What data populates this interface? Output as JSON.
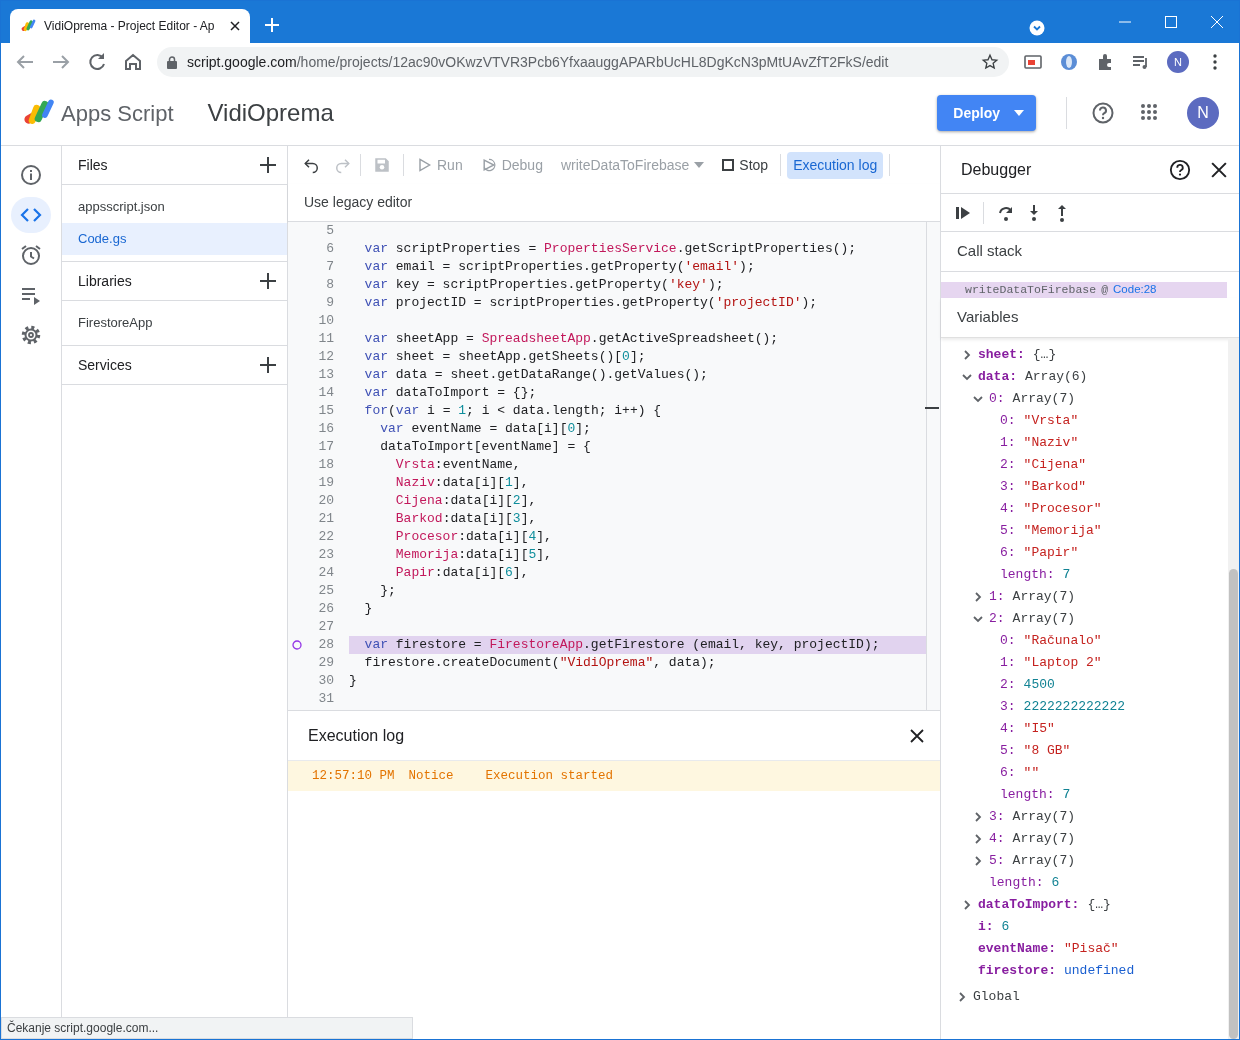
{
  "browser": {
    "tab_title": "VidiOprema - Project Editor - Ap",
    "url_host": "script.google.com",
    "url_path": "/home/projects/12ac90vOKwzVTVR3Pcb6YfxaauggAPARbUcHL8DgKcN3pMtUAvZfT2FkS/edit",
    "profile_initial": "N"
  },
  "app": {
    "product": "Apps Script",
    "project": "VidiOprema",
    "deploy_label": "Deploy",
    "account_initial": "N"
  },
  "rail": [
    {
      "selected": false
    },
    {
      "selected": true
    },
    {
      "selected": false
    },
    {
      "selected": false
    },
    {
      "selected": false
    }
  ],
  "sidebar": [
    {
      "title": "Files",
      "items": [
        {
          "label": "appsscript.json",
          "selected": false
        },
        {
          "label": "Code.gs",
          "selected": true
        }
      ]
    },
    {
      "title": "Libraries",
      "items": [
        {
          "label": "FirestoreApp",
          "selected": false
        }
      ]
    },
    {
      "title": "Services"
    }
  ],
  "toolbar": {
    "history": [
      {
        "disabled": false
      },
      {
        "disabled": true
      }
    ],
    "save": {
      "disabled": true
    },
    "actions": [
      {
        "label": "Run",
        "disabled": true
      },
      {
        "label": "Debug",
        "disabled": true
      }
    ],
    "function": {
      "label": "writeDataToFirebase",
      "disabled": true
    },
    "stop": "Stop",
    "log_button": {
      "label": "Execution log",
      "selected": true
    },
    "legacy_link": "Use legacy editor"
  },
  "code": [
    {
      "number": "5"
    },
    {
      "number": "6",
      "tokens": [
        {
          "kind": "keyword",
          "text": "  var"
        },
        {
          "kind": "plain",
          "text": " scriptProperties = "
        },
        {
          "kind": "class",
          "text": "PropertiesService"
        },
        {
          "kind": "plain",
          "text": ".getScriptProperties();"
        }
      ]
    },
    {
      "number": "7",
      "tokens": [
        {
          "kind": "keyword",
          "text": "  var"
        },
        {
          "kind": "plain",
          "text": " email = scriptProperties.getProperty("
        },
        {
          "kind": "string",
          "text": "'email'"
        },
        {
          "kind": "plain",
          "text": ");"
        }
      ]
    },
    {
      "number": "8",
      "tokens": [
        {
          "kind": "keyword",
          "text": "  var"
        },
        {
          "kind": "plain",
          "text": " key = scriptProperties.getProperty("
        },
        {
          "kind": "string",
          "text": "'key'"
        },
        {
          "kind": "plain",
          "text": ");"
        }
      ]
    },
    {
      "number": "9",
      "tokens": [
        {
          "kind": "keyword",
          "text": "  var"
        },
        {
          "kind": "plain",
          "text": " projectID = scriptProperties.getProperty("
        },
        {
          "kind": "string",
          "text": "'projectID'"
        },
        {
          "kind": "plain",
          "text": ");"
        }
      ]
    },
    {
      "number": "10"
    },
    {
      "number": "11",
      "tokens": [
        {
          "kind": "keyword",
          "text": "  var"
        },
        {
          "kind": "plain",
          "text": " sheetApp = "
        },
        {
          "kind": "class",
          "text": "SpreadsheetApp"
        },
        {
          "kind": "plain",
          "text": ".getActiveSpreadsheet();"
        }
      ]
    },
    {
      "number": "12",
      "tokens": [
        {
          "kind": "keyword",
          "text": "  var"
        },
        {
          "kind": "plain",
          "text": " sheet = sheetApp.getSheets()["
        },
        {
          "kind": "number",
          "text": "0"
        },
        {
          "kind": "plain",
          "text": "];"
        }
      ]
    },
    {
      "number": "13",
      "tokens": [
        {
          "kind": "keyword",
          "text": "  var"
        },
        {
          "kind": "plain",
          "text": " data = sheet.getDataRange().getValues();"
        }
      ]
    },
    {
      "number": "14",
      "tokens": [
        {
          "kind": "keyword",
          "text": "  var"
        },
        {
          "kind": "plain",
          "text": " dataToImport = {};"
        }
      ]
    },
    {
      "number": "15",
      "tokens": [
        {
          "kind": "keyword",
          "text": "  for"
        },
        {
          "kind": "plain",
          "text": "("
        },
        {
          "kind": "keyword",
          "text": "var"
        },
        {
          "kind": "plain",
          "text": " i = "
        },
        {
          "kind": "number",
          "text": "1"
        },
        {
          "kind": "plain",
          "text": "; i < data.length; i++) {"
        }
      ]
    },
    {
      "number": "16",
      "tokens": [
        {
          "kind": "keyword",
          "text": "    var"
        },
        {
          "kind": "plain",
          "text": " eventName = data[i]["
        },
        {
          "kind": "number",
          "text": "0"
        },
        {
          "kind": "plain",
          "text": "];"
        }
      ]
    },
    {
      "number": "17",
      "tokens": [
        {
          "kind": "plain",
          "text": "    dataToImport[eventName] = {"
        }
      ]
    },
    {
      "number": "18",
      "tokens": [
        {
          "kind": "property",
          "text": "      Vrsta"
        },
        {
          "kind": "plain",
          "text": ":eventName,"
        }
      ]
    },
    {
      "number": "19",
      "tokens": [
        {
          "kind": "property",
          "text": "      Naziv"
        },
        {
          "kind": "plain",
          "text": ":data[i]["
        },
        {
          "kind": "number",
          "text": "1"
        },
        {
          "kind": "plain",
          "text": "],"
        }
      ]
    },
    {
      "number": "20",
      "tokens": [
        {
          "kind": "property",
          "text": "      Cijena"
        },
        {
          "kind": "plain",
          "text": ":data[i]["
        },
        {
          "kind": "number",
          "text": "2"
        },
        {
          "kind": "plain",
          "text": "],"
        }
      ]
    },
    {
      "number": "21",
      "tokens": [
        {
          "kind": "property",
          "text": "      Barkod"
        },
        {
          "kind": "plain",
          "text": ":data[i]["
        },
        {
          "kind": "number",
          "text": "3"
        },
        {
          "kind": "plain",
          "text": "],"
        }
      ]
    },
    {
      "number": "22",
      "tokens": [
        {
          "kind": "property",
          "text": "      Procesor"
        },
        {
          "kind": "plain",
          "text": ":data[i]["
        },
        {
          "kind": "number",
          "text": "4"
        },
        {
          "kind": "plain",
          "text": "],"
        }
      ]
    },
    {
      "number": "23",
      "tokens": [
        {
          "kind": "property",
          "text": "      Memorija"
        },
        {
          "kind": "plain",
          "text": ":data[i]["
        },
        {
          "kind": "number",
          "text": "5"
        },
        {
          "kind": "plain",
          "text": "],"
        }
      ]
    },
    {
      "number": "24",
      "tokens": [
        {
          "kind": "property",
          "text": "      Papir"
        },
        {
          "kind": "plain",
          "text": ":data[i]["
        },
        {
          "kind": "number",
          "text": "6"
        },
        {
          "kind": "plain",
          "text": "],"
        }
      ]
    },
    {
      "number": "25",
      "tokens": [
        {
          "kind": "plain",
          "text": "    };"
        }
      ]
    },
    {
      "number": "26",
      "tokens": [
        {
          "kind": "plain",
          "text": "  }"
        }
      ]
    },
    {
      "number": "27"
    },
    {
      "number": "28",
      "breakpoint": true,
      "current": true,
      "tokens": [
        {
          "kind": "keyword",
          "text": "  var"
        },
        {
          "kind": "plain",
          "text": " firestore = "
        },
        {
          "kind": "class",
          "text": "FirestoreApp"
        },
        {
          "kind": "plain",
          "text": ".getFirestore (email, key, projectID);"
        }
      ]
    },
    {
      "number": "29",
      "tokens": [
        {
          "kind": "plain",
          "text": "  firestore.createDocument("
        },
        {
          "kind": "string",
          "text": "\"VidiOprema\""
        },
        {
          "kind": "plain",
          "text": ", data);"
        }
      ]
    },
    {
      "number": "30",
      "tokens": [
        {
          "kind": "plain",
          "text": "}"
        }
      ]
    },
    {
      "number": "31"
    }
  ],
  "execution_log": {
    "title": "Execution log",
    "entries": [
      {
        "time": "12:57:10 PM",
        "level": "Notice",
        "message": "Execution started"
      }
    ]
  },
  "debugger": {
    "title": "Debugger",
    "call_stack": {
      "title": "Call stack",
      "frames": [
        {
          "function": "writeDataToFirebase",
          "at": "@",
          "location": "Code:28",
          "selected": true
        }
      ]
    },
    "variables": {
      "title": "Variables",
      "tree": [
        {
          "name": "sheet:",
          "value": "{…}",
          "kind": "object",
          "expanded": false
        },
        {
          "name": "data:",
          "value": "Array(6)",
          "kind": "object",
          "expanded": true,
          "children": [
            {
              "name": "0:",
              "value": "Array(7)",
              "kind": "object",
              "expanded": true,
              "children": [
                {
                  "name": "0:",
                  "value": "\"Vrsta\"",
                  "kind": "string"
                },
                {
                  "name": "1:",
                  "value": "\"Naziv\"",
                  "kind": "string"
                },
                {
                  "name": "2:",
                  "value": "\"Cijena\"",
                  "kind": "string"
                },
                {
                  "name": "3:",
                  "value": "\"Barkod\"",
                  "kind": "string"
                },
                {
                  "name": "4:",
                  "value": "\"Procesor\"",
                  "kind": "string"
                },
                {
                  "name": "5:",
                  "value": "\"Memorija\"",
                  "kind": "string"
                },
                {
                  "name": "6:",
                  "value": "\"Papir\"",
                  "kind": "string"
                },
                {
                  "name": "length:",
                  "value": "7",
                  "kind": "number"
                }
              ]
            },
            {
              "name": "1:",
              "value": "Array(7)",
              "kind": "object",
              "expanded": false
            },
            {
              "name": "2:",
              "value": "Array(7)",
              "kind": "object",
              "expanded": true,
              "children": [
                {
                  "name": "0:",
                  "value": "\"Računalo\"",
                  "kind": "string"
                },
                {
                  "name": "1:",
                  "value": "\"Laptop 2\"",
                  "kind": "string"
                },
                {
                  "name": "2:",
                  "value": "4500",
                  "kind": "number"
                },
                {
                  "name": "3:",
                  "value": "2222222222222",
                  "kind": "number"
                },
                {
                  "name": "4:",
                  "value": "\"I5\"",
                  "kind": "string"
                },
                {
                  "name": "5:",
                  "value": "\"8 GB\"",
                  "kind": "string"
                },
                {
                  "name": "6:",
                  "value": "\"\"",
                  "kind": "string"
                },
                {
                  "name": "length:",
                  "value": "7",
                  "kind": "number"
                }
              ]
            },
            {
              "name": "3:",
              "value": "Array(7)",
              "kind": "object",
              "expanded": false
            },
            {
              "name": "4:",
              "value": "Array(7)",
              "kind": "object",
              "expanded": false
            },
            {
              "name": "5:",
              "value": "Array(7)",
              "kind": "object",
              "expanded": false
            },
            {
              "name": "length:",
              "value": "6",
              "kind": "number"
            }
          ]
        },
        {
          "name": "dataToImport:",
          "value": "{…}",
          "kind": "object",
          "expanded": false
        },
        {
          "name": "i:",
          "value": "6",
          "kind": "number"
        },
        {
          "name": "eventName:",
          "value": "\"Pisač\"",
          "kind": "string"
        },
        {
          "name": "firestore:",
          "value": "undefined",
          "kind": "undefined"
        }
      ]
    },
    "scopes": [
      {
        "label": "Global",
        "expanded": false
      }
    ]
  },
  "status_bar": "Čekanje script.google.com..."
}
